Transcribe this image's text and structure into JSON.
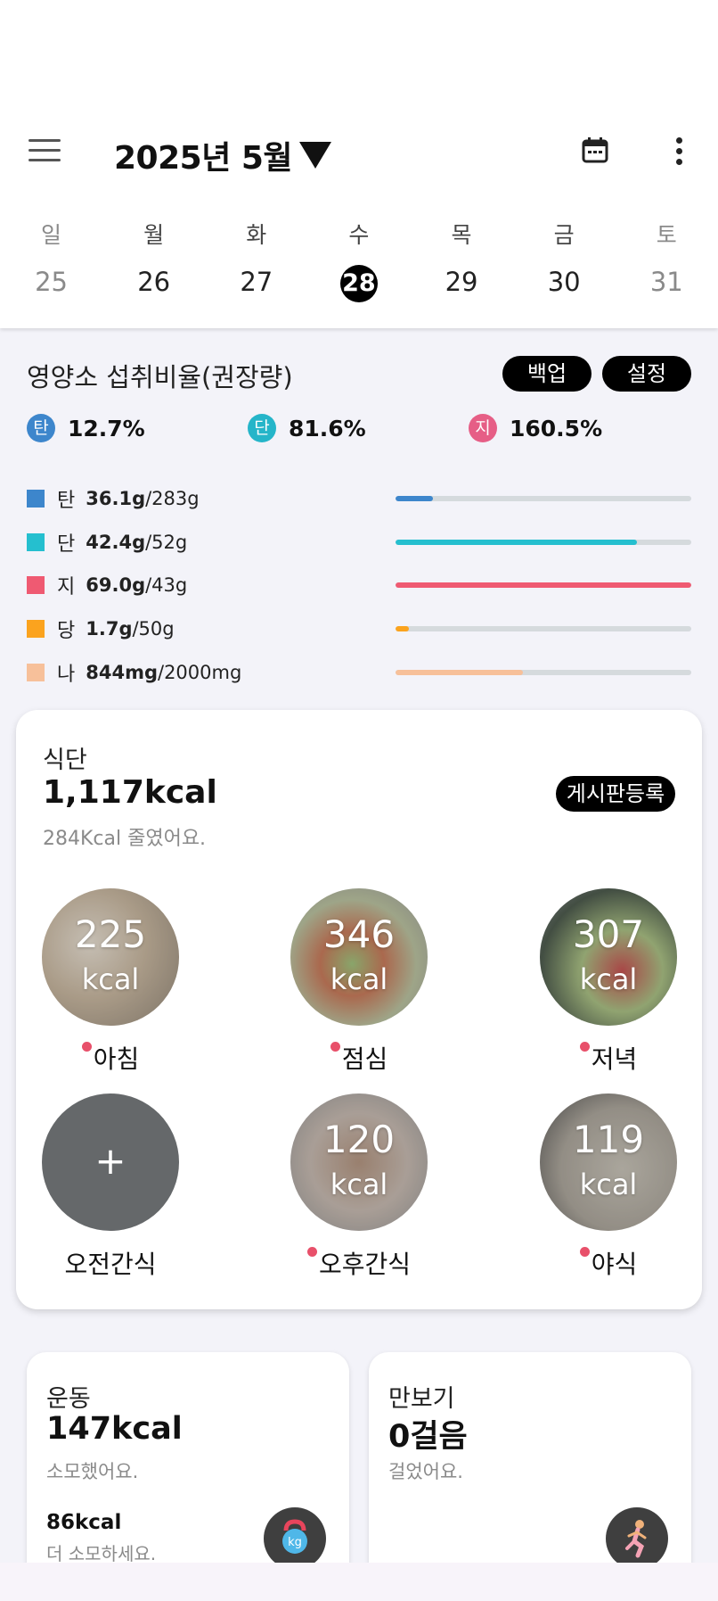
{
  "header": {
    "title": "2025년 5월",
    "icons": {
      "menu": "menu-icon",
      "calendar": "calendar-icon",
      "more": "more-vert-icon"
    }
  },
  "week": {
    "days": [
      {
        "dow": "일",
        "num": "25"
      },
      {
        "dow": "월",
        "num": "26"
      },
      {
        "dow": "화",
        "num": "27"
      },
      {
        "dow": "수",
        "num": "28"
      },
      {
        "dow": "목",
        "num": "29"
      },
      {
        "dow": "금",
        "num": "30"
      },
      {
        "dow": "토",
        "num": "31"
      }
    ],
    "selected": "28"
  },
  "nutrition": {
    "title": "영양소 섭취비율(권장량)",
    "backup_label": "백업",
    "settings_label": "설정",
    "ratios": [
      {
        "badge": "탄",
        "pct": "12.7%",
        "color": "#3d86cc"
      },
      {
        "badge": "단",
        "pct": "81.6%",
        "color": "#25b5c9"
      },
      {
        "badge": "지",
        "pct": "160.5%",
        "color": "#e65e86"
      }
    ],
    "rows": [
      {
        "label": "탄",
        "value": "36.1g",
        "total": "/283g",
        "progress": 0.128,
        "color": "#3d86cc"
      },
      {
        "label": "단",
        "value": "42.4g",
        "total": "/52g",
        "progress": 0.815,
        "color": "#25bfcf"
      },
      {
        "label": "지",
        "value": "69.0g",
        "total": "/43g",
        "progress": 1.0,
        "color": "#ef5a72"
      },
      {
        "label": "당",
        "value": "1.7g",
        "total": "/50g",
        "progress": 0.045,
        "color": "#fba31e"
      },
      {
        "label": "나",
        "value": "844mg",
        "total": "/2000mg",
        "progress": 0.43,
        "color": "#f7c09a"
      }
    ]
  },
  "diet": {
    "label": "식단",
    "kcal": "1,117kcal",
    "sub": "284Kcal 줄였어요.",
    "board_label": "게시판등록",
    "meals": [
      {
        "name": "아침",
        "kcal": "225",
        "unit": "kcal"
      },
      {
        "name": "점심",
        "kcal": "346",
        "unit": "kcal"
      },
      {
        "name": "저녁",
        "kcal": "307",
        "unit": "kcal"
      },
      {
        "name": "오전간식",
        "plus": "+"
      },
      {
        "name": "오후간식",
        "kcal": "120",
        "unit": "kcal"
      },
      {
        "name": "야식",
        "kcal": "119",
        "unit": "kcal"
      }
    ]
  },
  "exercise": {
    "title": "운동",
    "kcal": "147kcal",
    "sub": "소모했어요.",
    "remain": "86kcal",
    "remain_sub": "더 소모하세요."
  },
  "pedometer": {
    "title": "만보기",
    "steps": "0걸음",
    "sub": "걸었어요."
  }
}
